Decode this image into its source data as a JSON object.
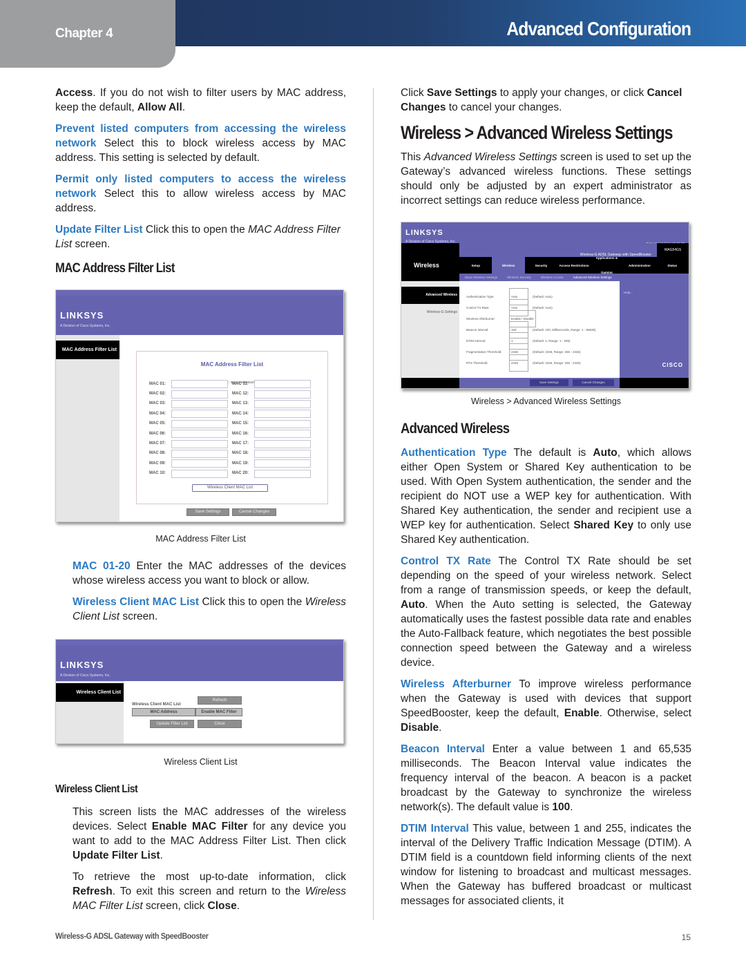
{
  "header": {
    "chapter": "Chapter 4",
    "title": "Advanced Configuration"
  },
  "left": {
    "p_access": {
      "b1": "Access",
      "t1": ". If you do not wish to filter users by MAC address, keep the default, ",
      "b2": "Allow All",
      "t2": "."
    },
    "p_prevent": {
      "term": "Prevent listed computers from accessing the wireless network",
      "text": " Select this to block wireless access by MAC address. This setting is selected by default."
    },
    "p_permit": {
      "term": "Permit only listed computers to access the wireless network",
      "text": " Select this to allow wireless access by MAC address."
    },
    "p_update": {
      "term": "Update Filter List",
      "t1": " Click this to open the ",
      "i1": "MAC Address Filter List",
      "t2": " screen."
    },
    "heading_mac_filter": "MAC Address Filter List",
    "mac_shot": {
      "logo": "LINKSYS",
      "logo_sub": "A Division of Cisco Systems, Inc.",
      "side_title": "MAC Address Filter List",
      "box_title": "MAC Address Filter List",
      "format": "Enter MAC Address Format: xxxxxxxxxxxx/xx:xx:xx:xx:xx:xx",
      "left_labels": [
        "MAC 01:",
        "MAC 02:",
        "MAC 03:",
        "MAC 04:",
        "MAC 05:",
        "MAC 06:",
        "MAC 07:",
        "MAC 08:",
        "MAC 09:",
        "MAC 10:"
      ],
      "right_labels": [
        "MAC 11:",
        "MAC 12:",
        "MAC 13:",
        "MAC 14:",
        "MAC 15:",
        "MAC 16:",
        "MAC 17:",
        "MAC 18:",
        "MAC 19:",
        "MAC 20:"
      ],
      "client_list_button": "Wireless Client MAC List",
      "save_button": "Save Settings",
      "cancel_button": "Cancel Changes"
    },
    "caption_mac": "MAC Address Filter List",
    "p_mac0120": {
      "term": "MAC 01-20",
      "text": " Enter the MAC addresses of the devices whose wireless access you want to block or allow."
    },
    "p_wcml": {
      "term": "Wireless Client MAC List",
      "t1": " Click this to open the ",
      "i1": "Wireless Client List",
      "t2": " screen."
    },
    "wcl_shot": {
      "logo": "LINKSYS",
      "logo_sub": "A Division of Cisco Systems, Inc.",
      "side_title": "Wireless Client List",
      "list_label": "Wireless Client MAC List",
      "refresh_button": "Refresh",
      "col_mac": "MAC Address",
      "col_enable": "Enable MAC Filter",
      "update_button": "Update Filter List",
      "close_button": "Close"
    },
    "caption_wcl": "Wireless Client List",
    "heading_wcl": "Wireless Client List",
    "p_wcl1": {
      "t1": "This screen lists the MAC addresses of the wireless devices. Select ",
      "b1": "Enable MAC Filter",
      "t2": " for any device you want to add to the MAC Address Filter List. Then click ",
      "b2": "Update Filter List",
      "t3": "."
    },
    "p_wcl2": {
      "t1": "To retrieve the most up-to-date information, click ",
      "b1": "Refresh",
      "t2": ". To exit this screen and return to the ",
      "i1": "Wireless MAC Filter List",
      "t3": " screen, click ",
      "b2": "Close",
      "t4": "."
    }
  },
  "right": {
    "p_save": {
      "t1": "Click ",
      "b1": "Save Settings",
      "t2": " to apply your changes, or click ",
      "b2": "Cancel Changes",
      "t3": " to cancel your changes."
    },
    "heading_main": "Wireless > Advanced Wireless Settings",
    "p_intro": {
      "t1": "This ",
      "i1": "Advanced Wireless Settings",
      "t2": " screen is used to set up the Gateway’s advanced wireless functions. These settings should only be adjusted by an expert administrator as incorrect settings can reduce wireless performance."
    },
    "aws_shot": {
      "logo": "LINKSYS",
      "logo_sub": "A Division of Cisco Systems, Inc.",
      "firmware": "Firmware Version: V1.01.00",
      "product": "Wireless-G ADSL Gateway with SpeedBooster",
      "model": "WAG54GS",
      "section": "Wireless",
      "tabs": [
        "Setup",
        "Wireless",
        "Security",
        "Access Restrictions",
        "Applications & Gaming",
        "Administration",
        "Status"
      ],
      "subtabs": [
        "Basic Wireless Settings",
        "Wireless Security",
        "Wireless Access",
        "Advanced Wireless Settings"
      ],
      "side_title": "Advanced Wireless",
      "side_sub": "Wireless-G Settings",
      "help": "Help...",
      "fields": [
        {
          "label": "Authentication Type:",
          "value": "Auto",
          "note": "(Default: Auto)"
        },
        {
          "label": "Control TX Rate:",
          "value": "Auto",
          "note": "(Default: Auto)"
        },
        {
          "label": "Wireless Afterburner:",
          "value": "Enable / Disable",
          "note": ""
        },
        {
          "label": "Beacon Interval:",
          "value": "100",
          "note": "(Default: 100, Milliseconds, Range: 1 - 65535)"
        },
        {
          "label": "DTIM Interval:",
          "value": "1",
          "note": "(Default: 1, Range: 1 - 255)"
        },
        {
          "label": "Fragmentation Threshold:",
          "value": "2346",
          "note": "(Default: 2346, Range: 256 - 2346)"
        },
        {
          "label": "RTS Threshold:",
          "value": "2346",
          "note": "(Default: 2346, Range: 256 - 2346)"
        }
      ],
      "radio_enable": "Enable",
      "radio_disable": "Disable",
      "save_button": "Save Settings",
      "cancel_button": "Cancel Changes",
      "cisco": "CISCO"
    },
    "caption_aws": "Wireless > Advanced Wireless Settings",
    "heading_adv": "Advanced Wireless",
    "p_auth": {
      "term": "Authentication Type",
      "t1": "  The default is ",
      "b1": "Auto",
      "t2": ", which allows either Open System or Shared Key authentication to be used. With Open System authentication, the sender and the recipient do NOT use a WEP key for authentication. With Shared Key authentication, the sender and recipient use a WEP key for authentication. Select ",
      "b2": "Shared Key",
      "t3": " to only use Shared Key authentication."
    },
    "p_ctx": {
      "term": "Control TX Rate",
      "t1": " The Control TX Rate should be set depending on the speed of your wireless network. Select from a range of transmission speeds, or keep the default, ",
      "b1": "Auto",
      "t2": ". When the Auto setting is selected, the Gateway automatically uses the fastest possible data rate and enables the Auto-Fallback feature, which negotiates the best possible connection speed between the Gateway and a wireless device."
    },
    "p_wa": {
      "term": "Wireless Afterburner",
      "t1": "  To improve wireless performance when the Gateway is used with devices that support SpeedBooster, keep the default, ",
      "b1": "Enable",
      "t2": ". Otherwise, select ",
      "b2": "Disable",
      "t3": "."
    },
    "p_beacon": {
      "term": "Beacon Interval",
      "t1": "  Enter a value between 1 and 65,535 milliseconds. The Beacon Interval value indicates the frequency interval of the beacon. A beacon is a packet broadcast by the Gateway to synchronize the wireless network(s). The default value is ",
      "b1": "100",
      "t2": "."
    },
    "p_dtim": {
      "term": "DTIM Interval",
      "t1": "  This value, between 1 and 255, indicates the interval of the Delivery Traffic Indication Message (DTIM). A DTIM field is a countdown field informing clients of the next window for listening to broadcast and multicast messages. When the Gateway has buffered broadcast or multicast messages for associated clients, it"
    }
  },
  "footer": {
    "product": "Wireless-G ADSL Gateway with SpeedBooster",
    "page": "15"
  }
}
